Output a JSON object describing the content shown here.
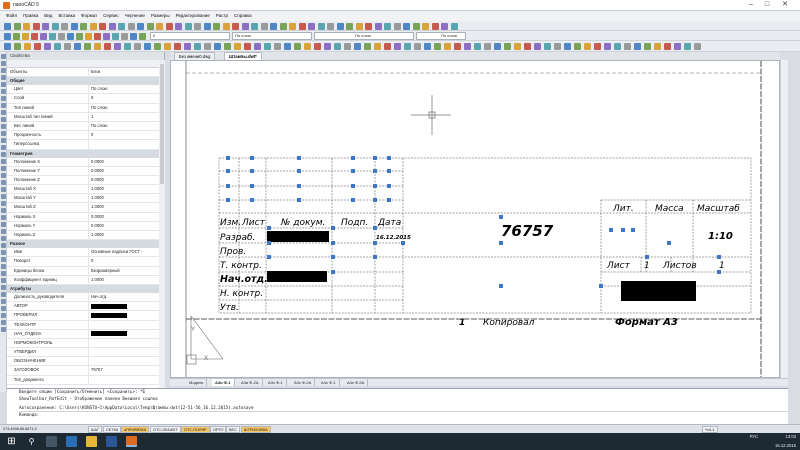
{
  "app": {
    "title": "nanoCAD 5"
  },
  "menu": [
    "Файл",
    "Правка",
    "Вид",
    "Вставка",
    "Формат",
    "Сервис",
    "Черчение",
    "Размеры",
    "Редактирование",
    "Растр",
    "Справка"
  ],
  "toolbar": {
    "layer_value": "0",
    "color_value": "По слою",
    "linetype_value": "По слою",
    "lineweight_value": "По слою"
  },
  "doc_tabs": [
    {
      "label": "Без имени0.dwg"
    },
    {
      "label": "Штампы.dwt*"
    }
  ],
  "props": {
    "panel_title": "Свойства",
    "selector_key": "Объекты",
    "selector_value": "Блок",
    "sections": [
      {
        "title": "Общие",
        "rows": [
          {
            "k": "Цвет",
            "v": "По слою"
          },
          {
            "k": "Слой",
            "v": "0"
          },
          {
            "k": "Тип линий",
            "v": "По слою"
          },
          {
            "k": "Масштаб тип линий",
            "v": "1"
          },
          {
            "k": "Вес линий",
            "v": "По слою"
          },
          {
            "k": "Прозрачность",
            "v": "0"
          },
          {
            "k": "Гиперссылка",
            "v": ""
          }
        ]
      },
      {
        "title": "Геометрия",
        "rows": [
          {
            "k": "Положение X",
            "v": "0.0000"
          },
          {
            "k": "Положение Y",
            "v": "0.0000"
          },
          {
            "k": "Положение Z",
            "v": "0.0000"
          },
          {
            "k": "Масштаб X",
            "v": "1.0000"
          },
          {
            "k": "Масштаб Y",
            "v": "1.0000"
          },
          {
            "k": "Масштаб Z",
            "v": "1.0000"
          },
          {
            "k": "Нормаль X",
            "v": "0.0000"
          },
          {
            "k": "Нормаль Y",
            "v": "0.0000"
          },
          {
            "k": "Нормаль Z",
            "v": "1.0000"
          }
        ]
      },
      {
        "title": "Разное",
        "rows": [
          {
            "k": "Имя",
            "v": "Основные надписи ГОСТ -"
          },
          {
            "k": "Поворот",
            "v": "0"
          },
          {
            "k": "Единицы блока",
            "v": "Безразмерный"
          },
          {
            "k": "Коэффициент единиц",
            "v": "1.0000"
          }
        ]
      },
      {
        "title": "Атрибуты",
        "rows": [
          {
            "k": "Должность_руководителя",
            "v": "Нач.отд."
          },
          {
            "k": "АВТОР",
            "v": "",
            "redacted": true
          },
          {
            "k": "ПРОВЕРИЛ",
            "v": "",
            "redacted": true
          },
          {
            "k": "ТЕХКОНТР",
            "v": ""
          },
          {
            "k": "НАЧ_ОТДЕЛА",
            "v": "",
            "redacted": true
          },
          {
            "k": "НОРМОКОНТРОЛЬ",
            "v": ""
          },
          {
            "k": "УТВЕРДИЛ",
            "v": ""
          },
          {
            "k": "ОБОЗНАЧЕНИЕ",
            "v": ""
          },
          {
            "k": "ЗАГОЛОВОК",
            "v": "76757"
          },
          {
            "k": "Тип_документа",
            "v": ""
          }
        ]
      }
    ]
  },
  "stamp": {
    "hdr_izm": "Изм.",
    "hdr_list": "Лист",
    "hdr_ndokum": "№ докум.",
    "hdr_podp": "Подп.",
    "hdr_data": "Дата",
    "r_razrab": "Разраб.",
    "r_prov": "Пров.",
    "r_tkontr": "Т. контр.",
    "r_nachotd": "Нач.отд.",
    "r_nkontr": "Н. контр.",
    "r_utv": "Утв.",
    "date": "16.12.2015",
    "designation": "76757",
    "lit": "Лит.",
    "massa": "Масса",
    "masshtab": "Масштаб",
    "scale_value": "1:10",
    "list_label": "Лист",
    "list_value": "1",
    "listov_label": "Листов",
    "listov_value": "1",
    "kopiroval": "Копировал",
    "format": "Формат А3",
    "footer_num": "1"
  },
  "layout_tabs": [
    "Модель",
    "А3и Ф-1",
    "А3и Ф-2А",
    "А3х Ф-1",
    "А3х Ф-2А",
    "А4х Ф-1",
    "А4х Ф-2А"
  ],
  "cmd": {
    "lines": [
      "Введите опции [Сохранить/Отменить] <Сохранить>: *Б",
      "ShowToolbar_RefEdit - Отображение панели Внешняя ссылка",
      "",
      "Автосохранение: C:\\Users\\KONSTU~1\\AppData\\Local\\Temp\\Штампы.dwt(12-51-56_16.12.2015).autosave"
    ],
    "prompt": "Команда:"
  },
  "status": {
    "coords": "274.4948,66.6871,0",
    "buttons": [
      {
        "label": "ШАГ",
        "on": false
      },
      {
        "label": "СЕТКА",
        "on": false
      },
      {
        "label": "оПРИВЯЗКА",
        "on": true
      },
      {
        "label": "ОТС-ОБЪЕКТ",
        "on": false
      },
      {
        "label": "ОТС-ПОЛЯР",
        "on": true
      },
      {
        "label": "ОРТО",
        "on": false
      },
      {
        "label": "ВЕС",
        "on": false
      },
      {
        "label": "ШТРИХОВКА",
        "on": true
      }
    ],
    "scale": "*m1:1"
  },
  "taskbar": {
    "lang": "РУС",
    "time": "13:03",
    "date": "16.12.2015"
  }
}
